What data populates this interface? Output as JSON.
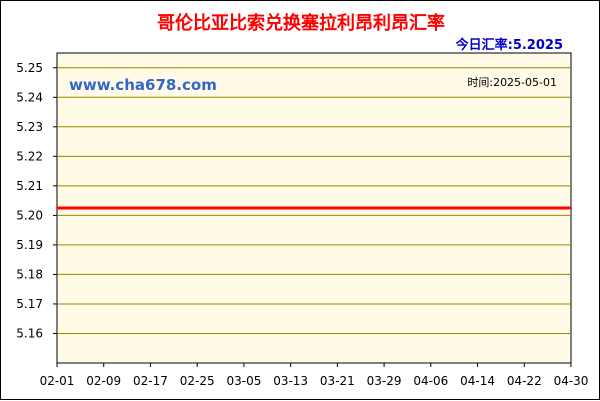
{
  "chart_data": {
    "type": "line",
    "title": "哥伦比亚比索兑换塞拉利昂利昂汇率",
    "current_rate_label": "今日汇率:5.2025",
    "watermark": "www.cha678.com",
    "date_label": "时间:2025-05-01",
    "x_tick_labels": [
      "02-01",
      "02-09",
      "02-17",
      "02-25",
      "03-05",
      "03-13",
      "03-21",
      "03-29",
      "04-06",
      "04-14",
      "04-22",
      "04-30"
    ],
    "y_tick_labels": [
      "5.25",
      "5.24",
      "5.23",
      "5.22",
      "5.21",
      "5.20",
      "5.19",
      "5.18",
      "5.17",
      "5.16"
    ],
    "ylim": [
      5.15,
      5.255
    ],
    "series": [
      {
        "x": [
          "02-01",
          "04-30"
        ],
        "values": [
          5.2025,
          5.2025
        ]
      }
    ],
    "colors": {
      "line": "#ff0000",
      "plot_bg": "#fffbe6",
      "grid": "#998800",
      "title": "#ff0000",
      "rate": "#0000cc",
      "watermark": "#3366cc"
    },
    "grid": true
  }
}
